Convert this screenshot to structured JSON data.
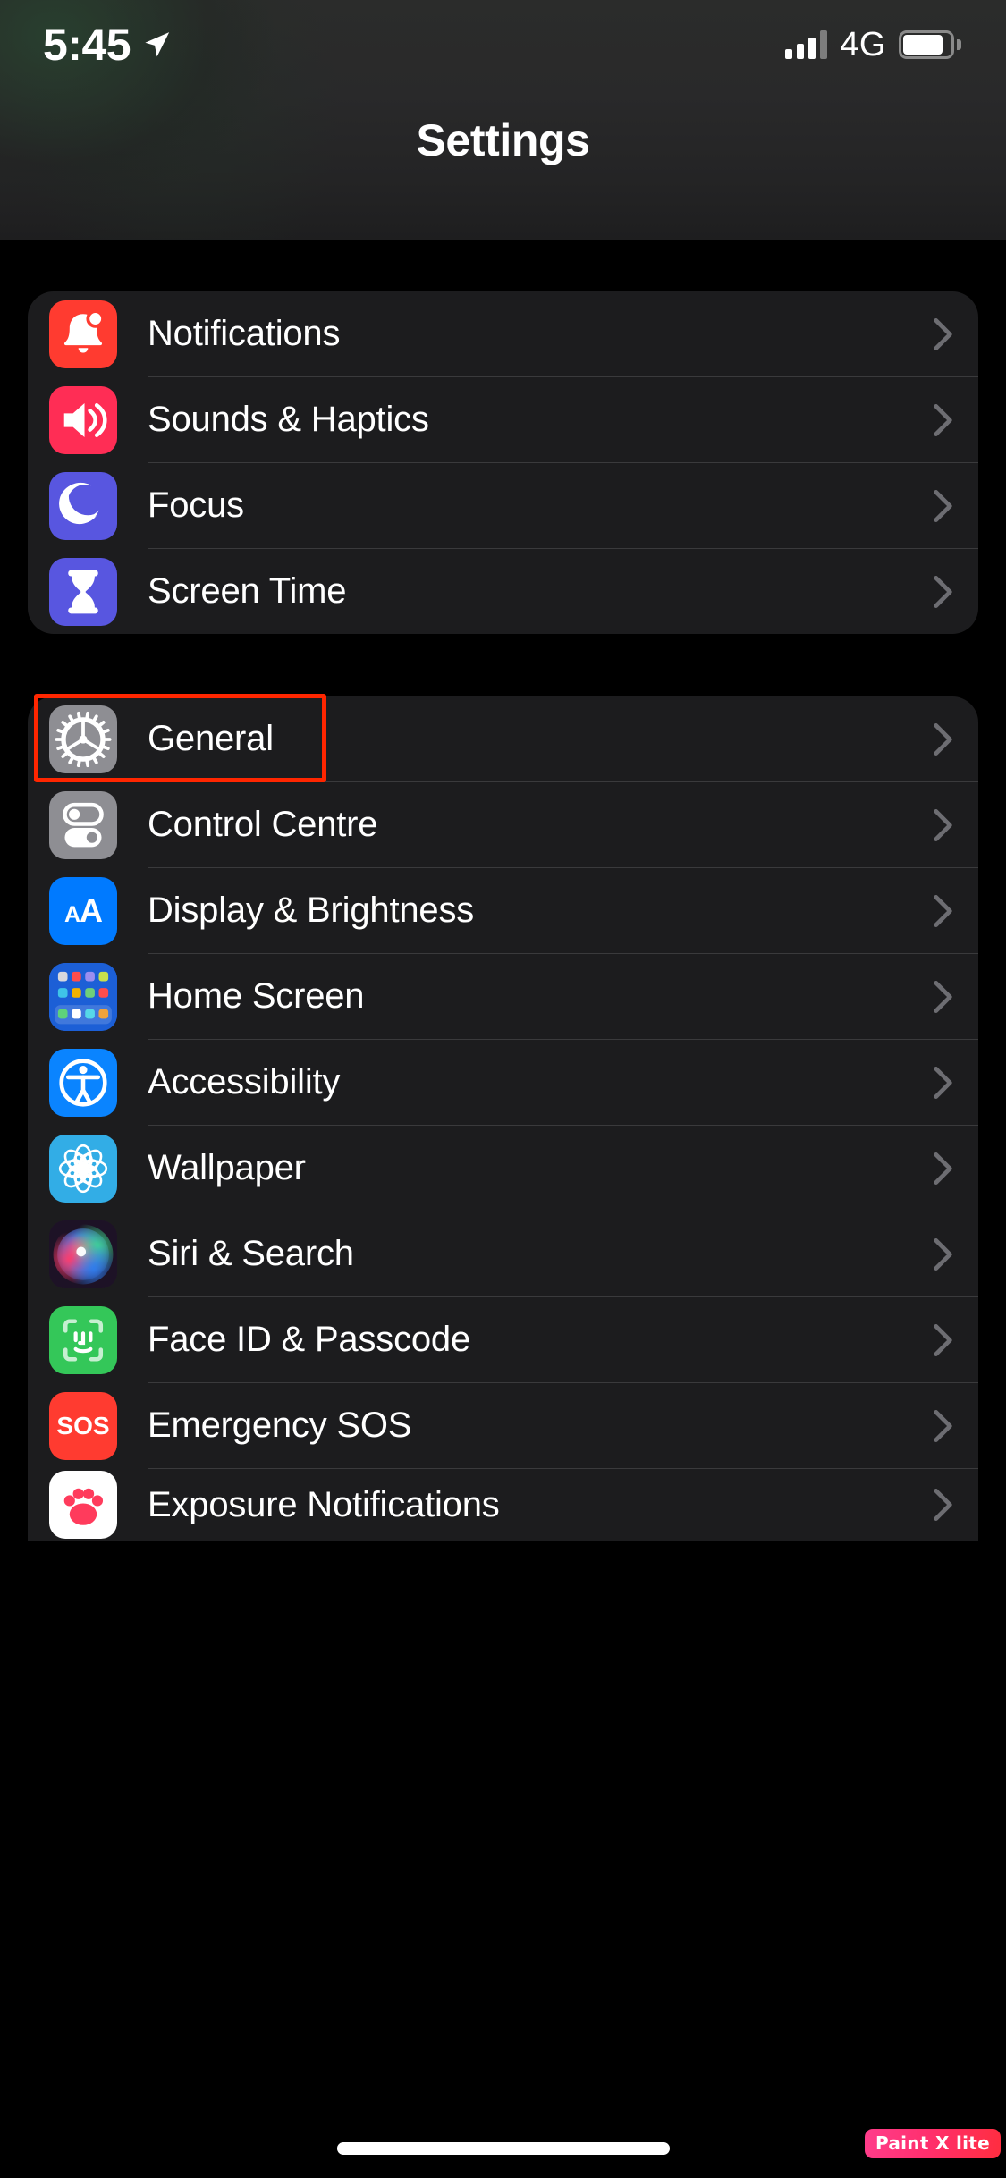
{
  "status_bar": {
    "time": "5:45",
    "location_icon": "location-arrow-icon",
    "signal_icon": "cellular-signal-icon",
    "network": "4G",
    "battery_icon": "battery-icon"
  },
  "header": {
    "title": "Settings"
  },
  "groups": [
    {
      "id": "group-alerts",
      "rows": [
        {
          "label": "Notifications",
          "icon": "bell-icon",
          "icon_bg": "#ff3b30",
          "chevron": "chevron-right-icon"
        },
        {
          "label": "Sounds & Haptics",
          "icon": "speaker-wave-icon",
          "icon_bg": "#ff2d55",
          "chevron": "chevron-right-icon"
        },
        {
          "label": "Focus",
          "icon": "moon-crescent-icon",
          "icon_bg": "#5856e0",
          "chevron": "chevron-right-icon"
        },
        {
          "label": "Screen Time",
          "icon": "hourglass-icon",
          "icon_bg": "#5856e0",
          "chevron": "chevron-right-icon"
        }
      ]
    },
    {
      "id": "group-system",
      "rows": [
        {
          "label": "General",
          "icon": "gear-icon",
          "icon_bg": "#8e8e93",
          "chevron": "chevron-right-icon",
          "highlighted": true
        },
        {
          "label": "Control Centre",
          "icon": "toggles-icon",
          "icon_bg": "#8e8e93",
          "chevron": "chevron-right-icon"
        },
        {
          "label": "Display & Brightness",
          "icon": "text-size-aa-icon",
          "icon_bg": "#007aff",
          "chevron": "chevron-right-icon"
        },
        {
          "label": "Home Screen",
          "icon": "app-grid-icon",
          "icon_bg": "#1c5fd6",
          "chevron": "chevron-right-icon"
        },
        {
          "label": "Accessibility",
          "icon": "accessibility-icon",
          "icon_bg": "#0a84ff",
          "chevron": "chevron-right-icon"
        },
        {
          "label": "Wallpaper",
          "icon": "flower-pattern-icon",
          "icon_bg": "#32ade6",
          "chevron": "chevron-right-icon"
        },
        {
          "label": "Siri & Search",
          "icon": "siri-orb-icon",
          "icon_bg": "#2a1a2e",
          "chevron": "chevron-right-icon"
        },
        {
          "label": "Face ID & Passcode",
          "icon": "face-id-icon",
          "icon_bg": "#34c759",
          "chevron": "chevron-right-icon"
        },
        {
          "label": "Emergency SOS",
          "icon": "sos-icon",
          "icon_bg": "#ff3b30",
          "chevron": "chevron-right-icon"
        },
        {
          "label": "Exposure Notifications",
          "icon": "paw-icon",
          "icon_bg": "#ffffff",
          "chevron": "chevron-right-icon",
          "cut_off": true
        }
      ]
    }
  ],
  "annotation": {
    "highlight_color": "#ff2600",
    "target_label": "General"
  },
  "watermark": {
    "text": "Paint X lite"
  },
  "home_indicator": "home-indicator"
}
